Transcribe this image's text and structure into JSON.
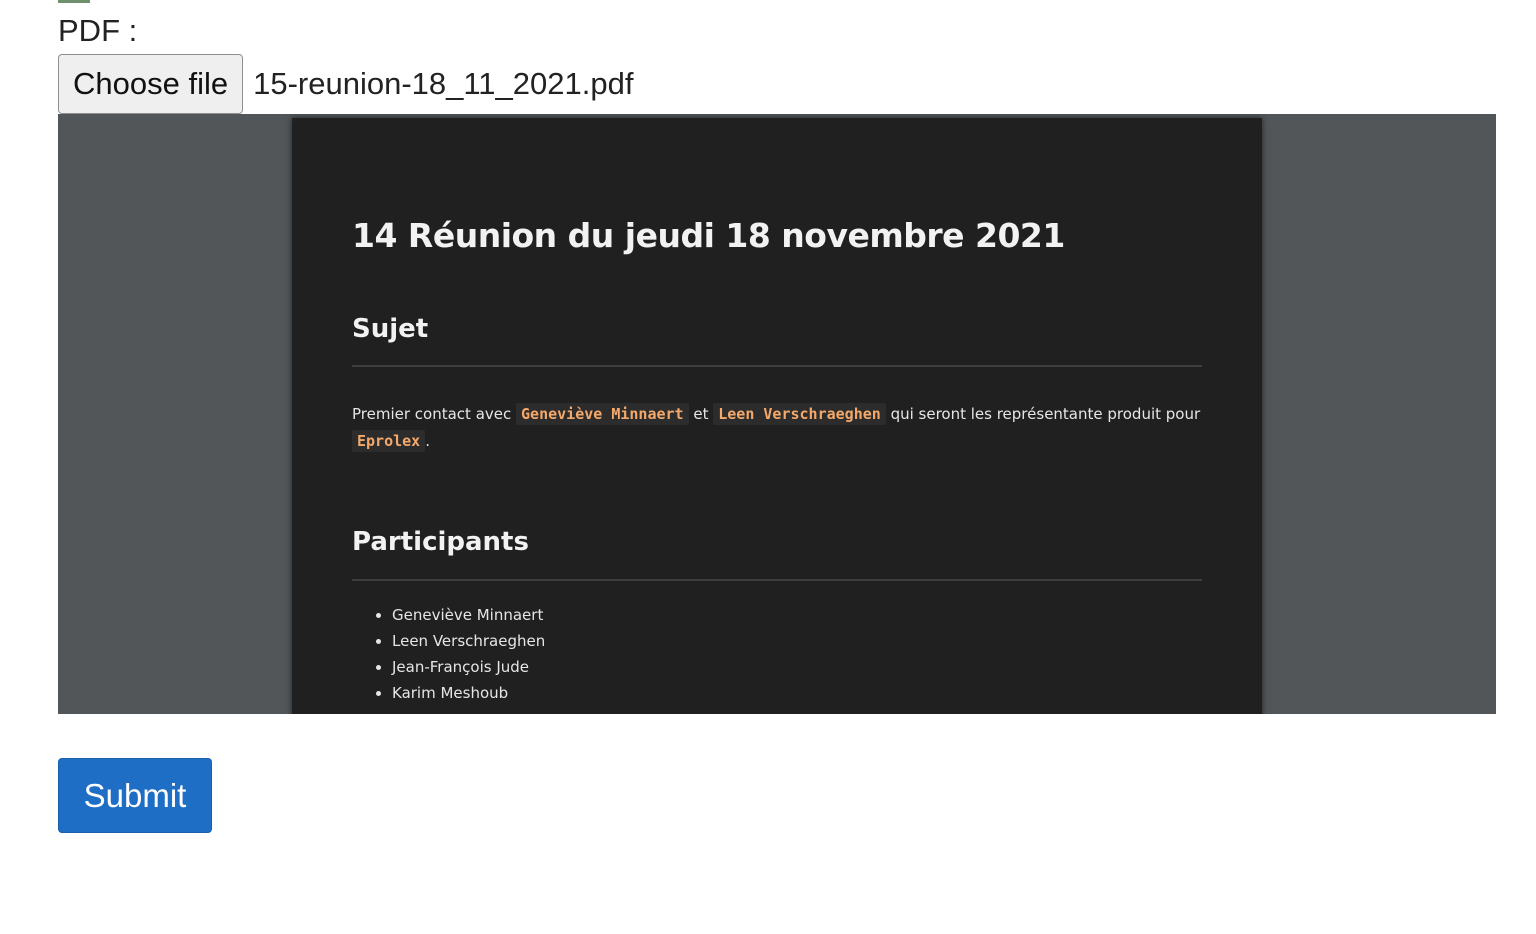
{
  "form": {
    "pdf_label": "PDF :",
    "choose_file_label": "Choose file",
    "file_name": "15-reunion-18_11_2021.pdf",
    "submit_label": "Submit"
  },
  "document": {
    "title": "14 Réunion du jeudi 18 novembre 2021",
    "sujet_heading": "Sujet",
    "sujet_text": {
      "part1": "Premier contact avec ",
      "code1": "Geneviève Minnaert",
      "part2": " et ",
      "code2": "Leen Verschraeghen",
      "part3": " qui seront les représentante produit pour ",
      "code3": "Eprolex",
      "part4": "."
    },
    "participants_heading": "Participants",
    "participants": [
      "Geneviève Minnaert",
      "Leen Verschraeghen",
      "Jean-François Jude",
      "Karim Meshoub"
    ]
  },
  "colors": {
    "submit_bg": "#1e6ec5",
    "viewer_bg": "#525659",
    "page_bg": "#202020",
    "code_text": "#f4a96a"
  }
}
